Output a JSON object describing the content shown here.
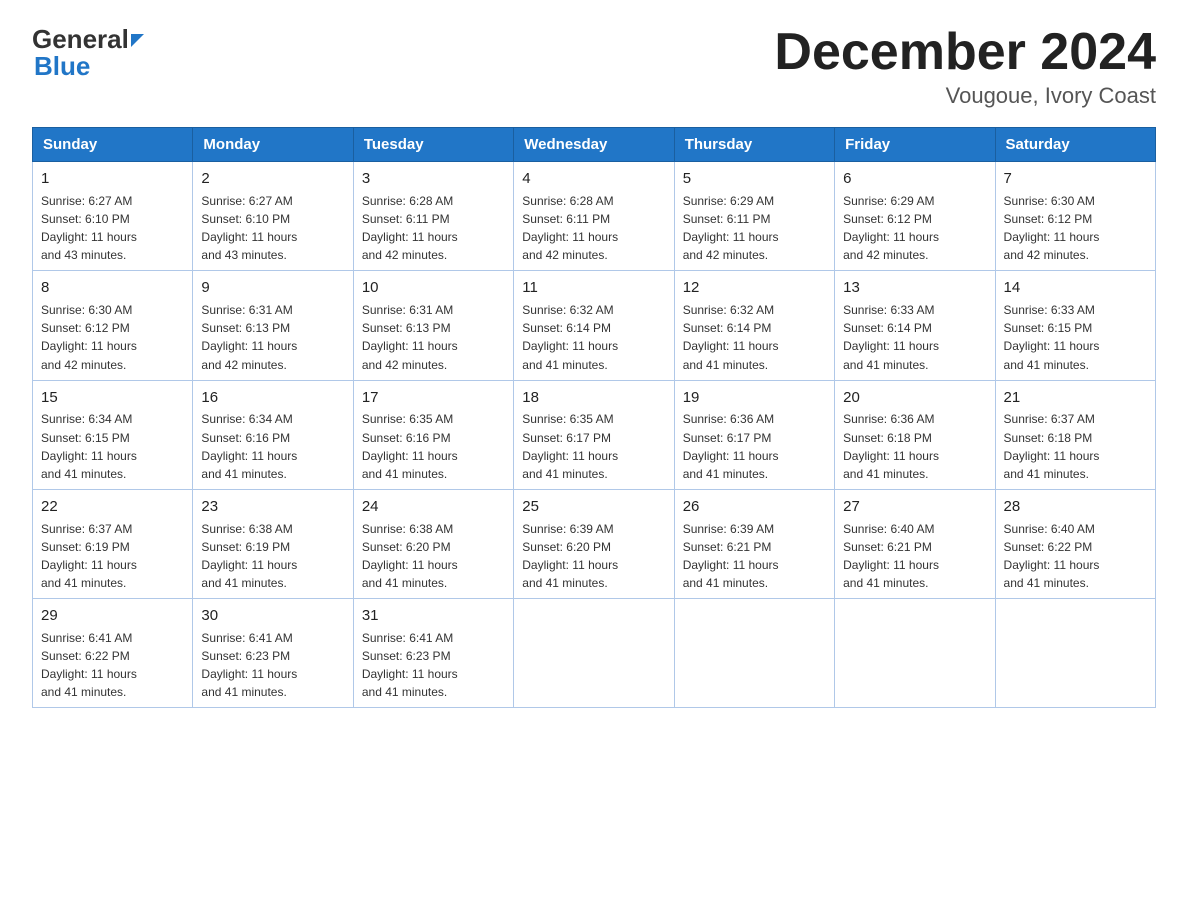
{
  "header": {
    "logo_general": "General",
    "logo_blue": "Blue",
    "month_title": "December 2024",
    "location": "Vougoue, Ivory Coast"
  },
  "days_of_week": [
    "Sunday",
    "Monday",
    "Tuesday",
    "Wednesday",
    "Thursday",
    "Friday",
    "Saturday"
  ],
  "weeks": [
    [
      {
        "day": "1",
        "sunrise": "6:27 AM",
        "sunset": "6:10 PM",
        "daylight": "11 hours and 43 minutes."
      },
      {
        "day": "2",
        "sunrise": "6:27 AM",
        "sunset": "6:10 PM",
        "daylight": "11 hours and 43 minutes."
      },
      {
        "day": "3",
        "sunrise": "6:28 AM",
        "sunset": "6:11 PM",
        "daylight": "11 hours and 42 minutes."
      },
      {
        "day": "4",
        "sunrise": "6:28 AM",
        "sunset": "6:11 PM",
        "daylight": "11 hours and 42 minutes."
      },
      {
        "day": "5",
        "sunrise": "6:29 AM",
        "sunset": "6:11 PM",
        "daylight": "11 hours and 42 minutes."
      },
      {
        "day": "6",
        "sunrise": "6:29 AM",
        "sunset": "6:12 PM",
        "daylight": "11 hours and 42 minutes."
      },
      {
        "day": "7",
        "sunrise": "6:30 AM",
        "sunset": "6:12 PM",
        "daylight": "11 hours and 42 minutes."
      }
    ],
    [
      {
        "day": "8",
        "sunrise": "6:30 AM",
        "sunset": "6:12 PM",
        "daylight": "11 hours and 42 minutes."
      },
      {
        "day": "9",
        "sunrise": "6:31 AM",
        "sunset": "6:13 PM",
        "daylight": "11 hours and 42 minutes."
      },
      {
        "day": "10",
        "sunrise": "6:31 AM",
        "sunset": "6:13 PM",
        "daylight": "11 hours and 42 minutes."
      },
      {
        "day": "11",
        "sunrise": "6:32 AM",
        "sunset": "6:14 PM",
        "daylight": "11 hours and 41 minutes."
      },
      {
        "day": "12",
        "sunrise": "6:32 AM",
        "sunset": "6:14 PM",
        "daylight": "11 hours and 41 minutes."
      },
      {
        "day": "13",
        "sunrise": "6:33 AM",
        "sunset": "6:14 PM",
        "daylight": "11 hours and 41 minutes."
      },
      {
        "day": "14",
        "sunrise": "6:33 AM",
        "sunset": "6:15 PM",
        "daylight": "11 hours and 41 minutes."
      }
    ],
    [
      {
        "day": "15",
        "sunrise": "6:34 AM",
        "sunset": "6:15 PM",
        "daylight": "11 hours and 41 minutes."
      },
      {
        "day": "16",
        "sunrise": "6:34 AM",
        "sunset": "6:16 PM",
        "daylight": "11 hours and 41 minutes."
      },
      {
        "day": "17",
        "sunrise": "6:35 AM",
        "sunset": "6:16 PM",
        "daylight": "11 hours and 41 minutes."
      },
      {
        "day": "18",
        "sunrise": "6:35 AM",
        "sunset": "6:17 PM",
        "daylight": "11 hours and 41 minutes."
      },
      {
        "day": "19",
        "sunrise": "6:36 AM",
        "sunset": "6:17 PM",
        "daylight": "11 hours and 41 minutes."
      },
      {
        "day": "20",
        "sunrise": "6:36 AM",
        "sunset": "6:18 PM",
        "daylight": "11 hours and 41 minutes."
      },
      {
        "day": "21",
        "sunrise": "6:37 AM",
        "sunset": "6:18 PM",
        "daylight": "11 hours and 41 minutes."
      }
    ],
    [
      {
        "day": "22",
        "sunrise": "6:37 AM",
        "sunset": "6:19 PM",
        "daylight": "11 hours and 41 minutes."
      },
      {
        "day": "23",
        "sunrise": "6:38 AM",
        "sunset": "6:19 PM",
        "daylight": "11 hours and 41 minutes."
      },
      {
        "day": "24",
        "sunrise": "6:38 AM",
        "sunset": "6:20 PM",
        "daylight": "11 hours and 41 minutes."
      },
      {
        "day": "25",
        "sunrise": "6:39 AM",
        "sunset": "6:20 PM",
        "daylight": "11 hours and 41 minutes."
      },
      {
        "day": "26",
        "sunrise": "6:39 AM",
        "sunset": "6:21 PM",
        "daylight": "11 hours and 41 minutes."
      },
      {
        "day": "27",
        "sunrise": "6:40 AM",
        "sunset": "6:21 PM",
        "daylight": "11 hours and 41 minutes."
      },
      {
        "day": "28",
        "sunrise": "6:40 AM",
        "sunset": "6:22 PM",
        "daylight": "11 hours and 41 minutes."
      }
    ],
    [
      {
        "day": "29",
        "sunrise": "6:41 AM",
        "sunset": "6:22 PM",
        "daylight": "11 hours and 41 minutes."
      },
      {
        "day": "30",
        "sunrise": "6:41 AM",
        "sunset": "6:23 PM",
        "daylight": "11 hours and 41 minutes."
      },
      {
        "day": "31",
        "sunrise": "6:41 AM",
        "sunset": "6:23 PM",
        "daylight": "11 hours and 41 minutes."
      },
      null,
      null,
      null,
      null
    ]
  ],
  "label_sunrise": "Sunrise:",
  "label_sunset": "Sunset:",
  "label_daylight": "Daylight:"
}
